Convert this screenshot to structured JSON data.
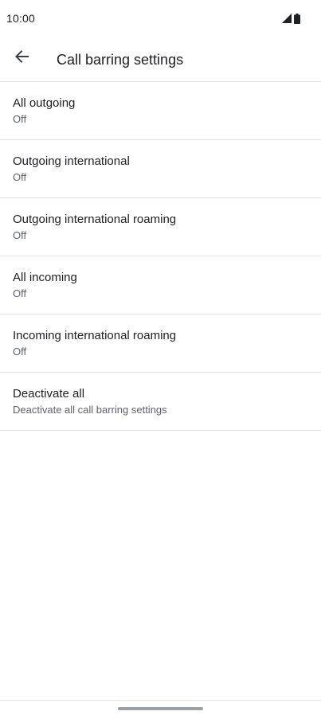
{
  "status_bar": {
    "time": "10:00",
    "icons": [
      "signal-icon",
      "battery-icon"
    ]
  },
  "app_bar": {
    "back_icon": "arrow-back-icon",
    "title": "Call barring settings"
  },
  "settings": [
    {
      "title": "All outgoing",
      "summary": "Off"
    },
    {
      "title": "Outgoing international",
      "summary": "Off"
    },
    {
      "title": "Outgoing international roaming",
      "summary": "Off"
    },
    {
      "title": "All incoming",
      "summary": "Off"
    },
    {
      "title": "Incoming international roaming",
      "summary": "Off"
    },
    {
      "title": "Deactivate all",
      "summary": "Deactivate all call barring settings"
    }
  ],
  "colors": {
    "text_primary": "#202124",
    "text_secondary": "#5f6368",
    "divider": "#e0e0e0"
  }
}
